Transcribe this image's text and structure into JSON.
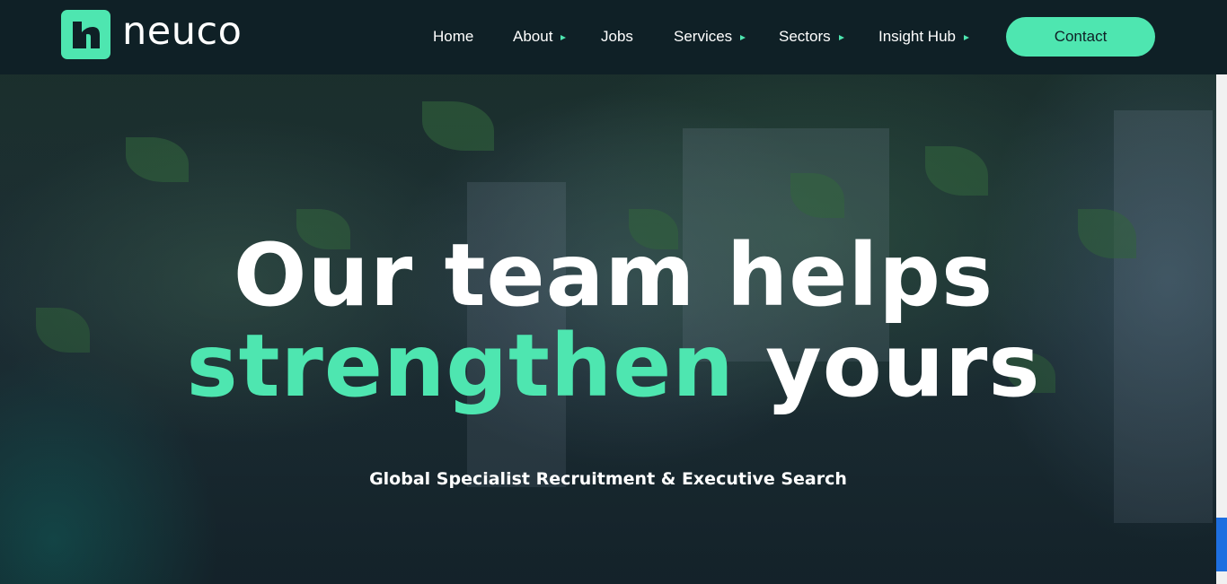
{
  "brand": {
    "name": "neuco",
    "accent_color": "#4ee6b0",
    "nav_bg": "#0f2026"
  },
  "nav": {
    "items": [
      {
        "label": "Home",
        "has_dropdown": false
      },
      {
        "label": "About",
        "has_dropdown": true
      },
      {
        "label": "Jobs",
        "has_dropdown": false
      },
      {
        "label": "Services",
        "has_dropdown": true
      },
      {
        "label": "Sectors",
        "has_dropdown": true
      },
      {
        "label": "Insight Hub",
        "has_dropdown": true
      }
    ],
    "contact_label": "Contact"
  },
  "hero": {
    "line1": "Our team helps",
    "line2_accent": "strengthen",
    "line2_rest": " yours",
    "subtitle": "Global Specialist Recruitment & Executive Search"
  }
}
